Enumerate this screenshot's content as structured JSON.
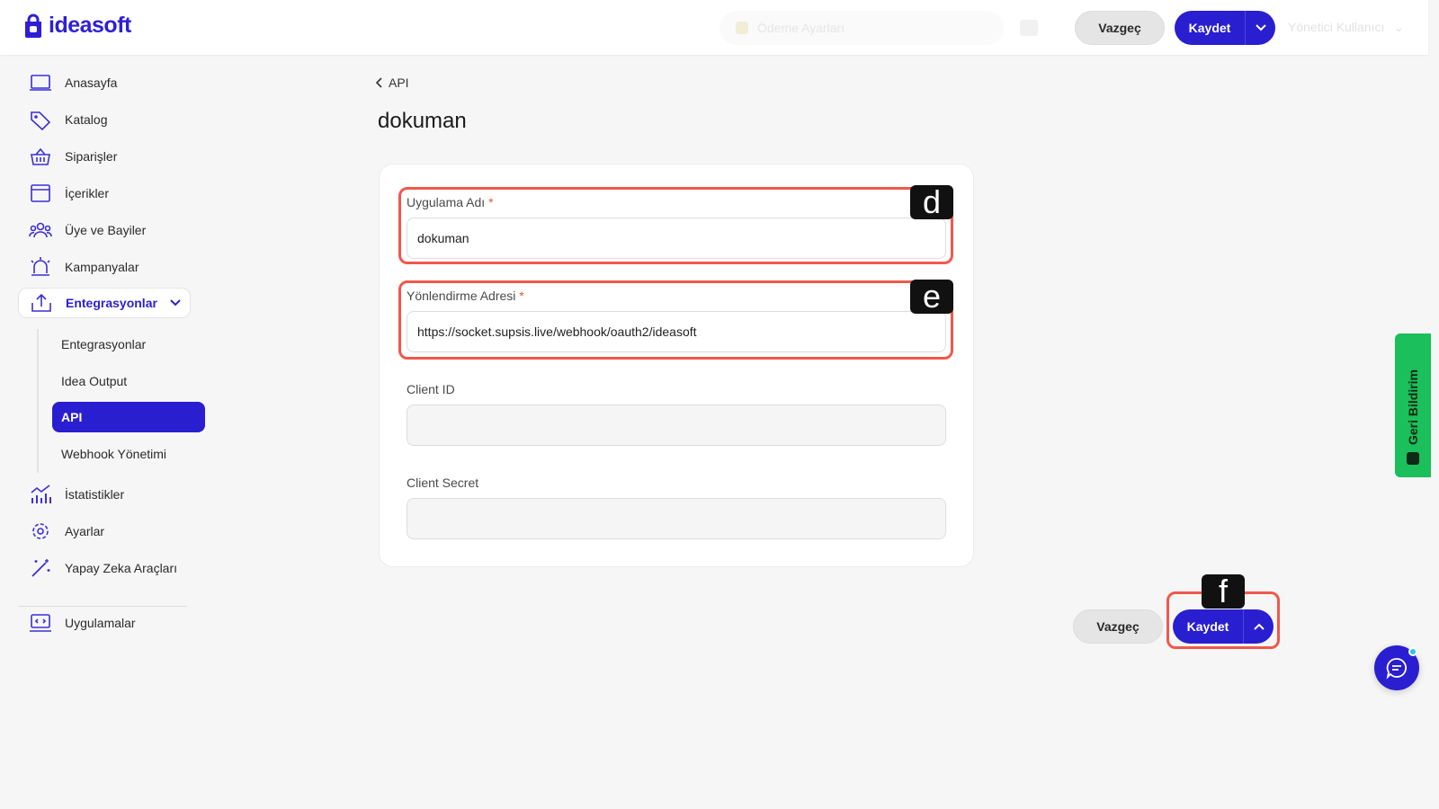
{
  "app": {
    "brand": "ideasoft"
  },
  "header": {
    "search_placeholder": "Ödeme Ayarları",
    "user": "Yönetici Kullanıcı",
    "cancel_label": "Vazgeç",
    "save_label": "Kaydet"
  },
  "sidebar": {
    "items": [
      {
        "label": "Anasayfa",
        "icon": "home-monitor-icon"
      },
      {
        "label": "Katalog",
        "icon": "tag-icon"
      },
      {
        "label": "Siparişler",
        "icon": "basket-icon"
      },
      {
        "label": "İçerikler",
        "icon": "window-icon"
      },
      {
        "label": "Üye ve Bayiler",
        "icon": "users-icon"
      },
      {
        "label": "Kampanyalar",
        "icon": "siren-icon"
      },
      {
        "label": "Entegrasyonlar",
        "icon": "upload-box-icon"
      },
      {
        "label": "İstatistikler",
        "icon": "bar-chart-icon"
      },
      {
        "label": "Ayarlar",
        "icon": "gear-icon"
      },
      {
        "label": "Yapay Zeka Araçları",
        "icon": "magic-wand-icon"
      },
      {
        "label": "Uygulamalar",
        "icon": "laptop-code-icon"
      }
    ],
    "sub_items": [
      {
        "label": "Entegrasyonlar"
      },
      {
        "label": "Idea Output"
      },
      {
        "label": "API"
      },
      {
        "label": "Webhook Yönetimi"
      }
    ]
  },
  "main": {
    "breadcrumb": "API",
    "title": "dokuman",
    "fields": {
      "app_name": {
        "label": "Uygulama Adı",
        "required": "*",
        "value": "dokuman"
      },
      "redirect": {
        "label": "Yönlendirme Adresi",
        "required": "*",
        "value": "https://socket.supsis.live/webhook/oauth2/ideasoft"
      },
      "client_id": {
        "label": "Client ID",
        "value": ""
      },
      "client_secret": {
        "label": "Client Secret",
        "value": ""
      }
    },
    "cancel_label": "Vazgeç",
    "save_label": "Kaydet"
  },
  "annotations": {
    "d": "d",
    "e": "e",
    "f": "f"
  },
  "feedback": {
    "label": "Geri Bildirim"
  },
  "colors": {
    "brand": "#2a1ed1",
    "highlight": "#f0584b",
    "feedback": "#1bbf5b"
  }
}
